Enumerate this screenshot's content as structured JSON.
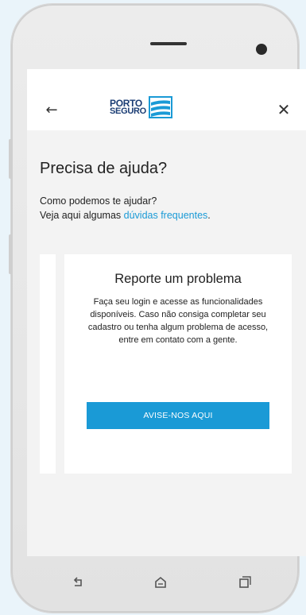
{
  "appbar": {
    "logo_line1": "PORTO",
    "logo_line2": "SEGURO"
  },
  "page": {
    "title": "Precisa de ajuda?",
    "intro_line1": "Como podemos te ajudar?",
    "intro_line2_prefix": "Veja aqui algumas ",
    "intro_line2_link": "dúvidas frequentes",
    "intro_line2_suffix": "."
  },
  "card": {
    "title": "Reporte um problema",
    "body": "Faça seu login e acesse as funcionalidades disponíveis. Caso não consiga completar seu cadastro ou tenha algum problema de acesso, entre em contato com a gente.",
    "button_label": "AVISE-NOS AQUI"
  },
  "icons": {
    "back": "arrow-left-icon",
    "close": "close-icon",
    "nav_back": "back-icon",
    "nav_home": "home-icon",
    "nav_recents": "recents-icon"
  },
  "colors": {
    "accent": "#1a9ad6",
    "logo_navy": "#1b3d74",
    "screen_bg": "#f3f3f3"
  }
}
